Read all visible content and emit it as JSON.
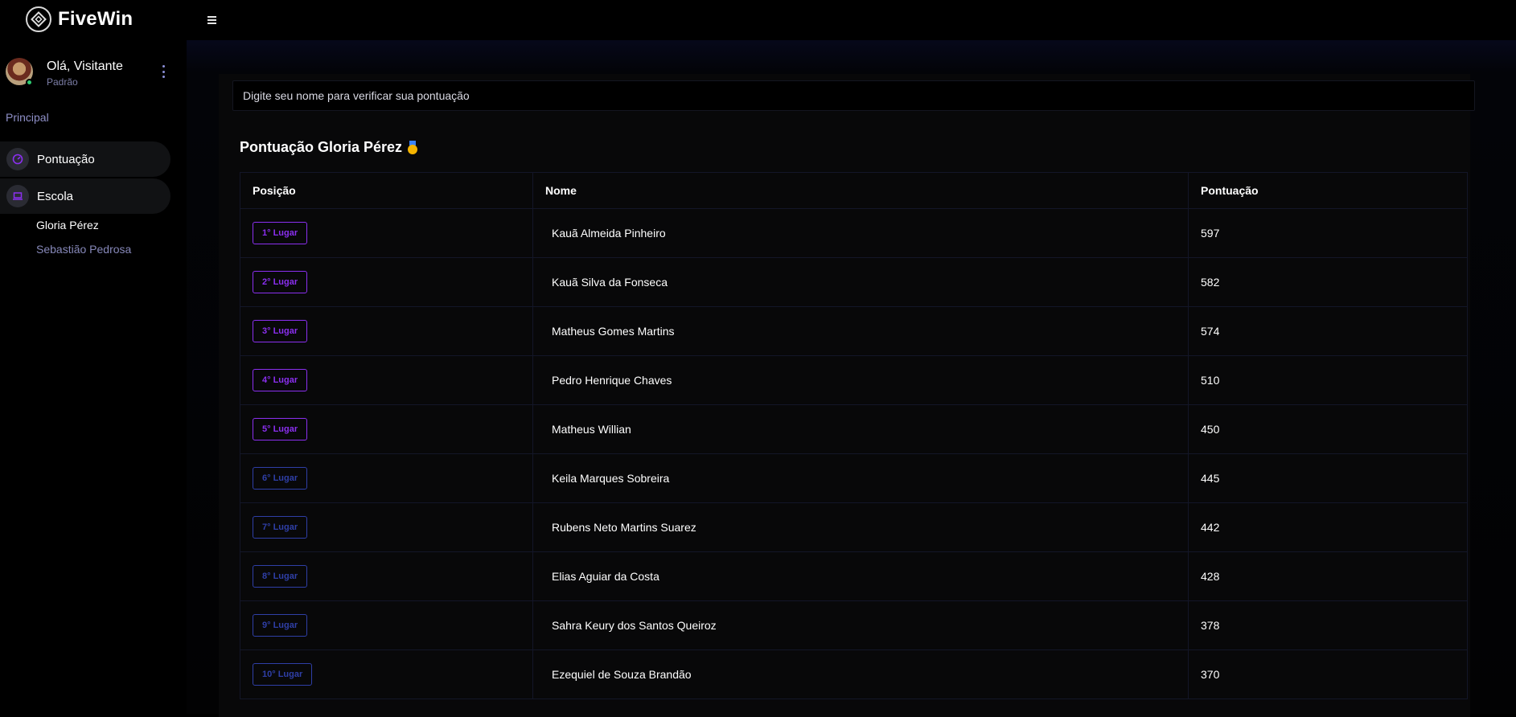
{
  "app": {
    "name": "FiveWin"
  },
  "user": {
    "greeting": "Olá, Visitante",
    "role": "Padrão"
  },
  "sidebar": {
    "section_label": "Principal",
    "items": [
      {
        "label": "Pontuação",
        "icon": "gauge-icon"
      },
      {
        "label": "Escola",
        "icon": "laptop-icon"
      }
    ],
    "subitems": [
      {
        "label": "Gloria Pérez",
        "active": true
      },
      {
        "label": "Sebastião Pedrosa",
        "active": false
      }
    ]
  },
  "search": {
    "placeholder": "Digite seu nome para verificar sua pontuação"
  },
  "ranking": {
    "title": "Pontuação Gloria Pérez",
    "title_icon": "medal-icon",
    "headers": {
      "position": "Posição",
      "name": "Nome",
      "score": "Pontuação"
    },
    "rows": [
      {
        "position": "1° Lugar",
        "name": "Kauã Almeida Pinheiro",
        "score": "597",
        "tier": "top"
      },
      {
        "position": "2° Lugar",
        "name": "Kauã Silva da Fonseca",
        "score": "582",
        "tier": "top"
      },
      {
        "position": "3° Lugar",
        "name": "Matheus Gomes Martins",
        "score": "574",
        "tier": "top"
      },
      {
        "position": "4° Lugar",
        "name": "Pedro Henrique Chaves",
        "score": "510",
        "tier": "top"
      },
      {
        "position": "5° Lugar",
        "name": "Matheus Willian",
        "score": "450",
        "tier": "top"
      },
      {
        "position": "6° Lugar",
        "name": "Keila Marques Sobreira",
        "score": "445",
        "tier": "low"
      },
      {
        "position": "7° Lugar",
        "name": "Rubens Neto Martins Suarez",
        "score": "442",
        "tier": "low"
      },
      {
        "position": "8° Lugar",
        "name": "Elias Aguiar da Costa",
        "score": "428",
        "tier": "low"
      },
      {
        "position": "9° Lugar",
        "name": "Sahra Keury dos Santos Queiroz",
        "score": "378",
        "tier": "low"
      },
      {
        "position": "10° Lugar",
        "name": "Ezequiel de Souza Brandão",
        "score": "370",
        "tier": "low"
      }
    ]
  },
  "colors": {
    "accent_top": "#8b2ff0",
    "accent_low": "#2f3fa7",
    "muted_text": "#8688b9"
  }
}
